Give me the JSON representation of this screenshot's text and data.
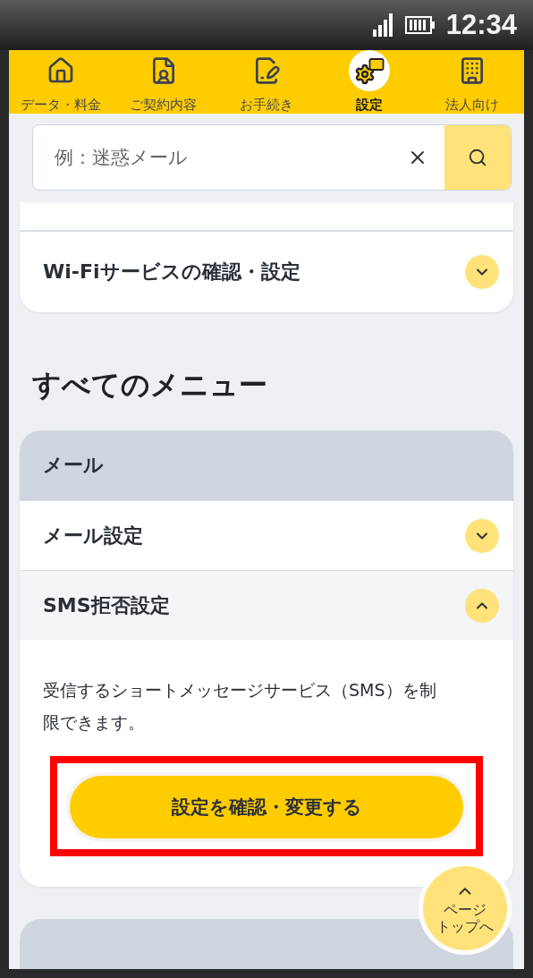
{
  "status_bar": {
    "time": "12:34"
  },
  "nav": [
    {
      "label": "データ・料金",
      "kind": "home",
      "selected": false
    },
    {
      "label": "ご契約内容",
      "kind": "contract",
      "selected": false
    },
    {
      "label": "お手続き",
      "kind": "form",
      "selected": false
    },
    {
      "label": "設定",
      "kind": "settings",
      "selected": true
    },
    {
      "label": "法人向け",
      "kind": "building",
      "selected": false
    }
  ],
  "search": {
    "placeholder": "例：迷惑メール"
  },
  "top_card": {
    "rows": [
      {
        "label": "Wi-Fiサービスの確認・設定",
        "expanded": false
      }
    ]
  },
  "section_title": "すべてのメニュー",
  "menu_card": {
    "header": "メール",
    "rows": [
      {
        "label": "メール設定",
        "expanded": false
      },
      {
        "label": "SMS拒否設定",
        "expanded": true,
        "description": "受信するショートメッセージサービス（SMS）を制限できます。",
        "button": "設定を確認・変更する"
      }
    ]
  },
  "page_top": {
    "lines": [
      "ページ",
      "トップへ"
    ]
  }
}
